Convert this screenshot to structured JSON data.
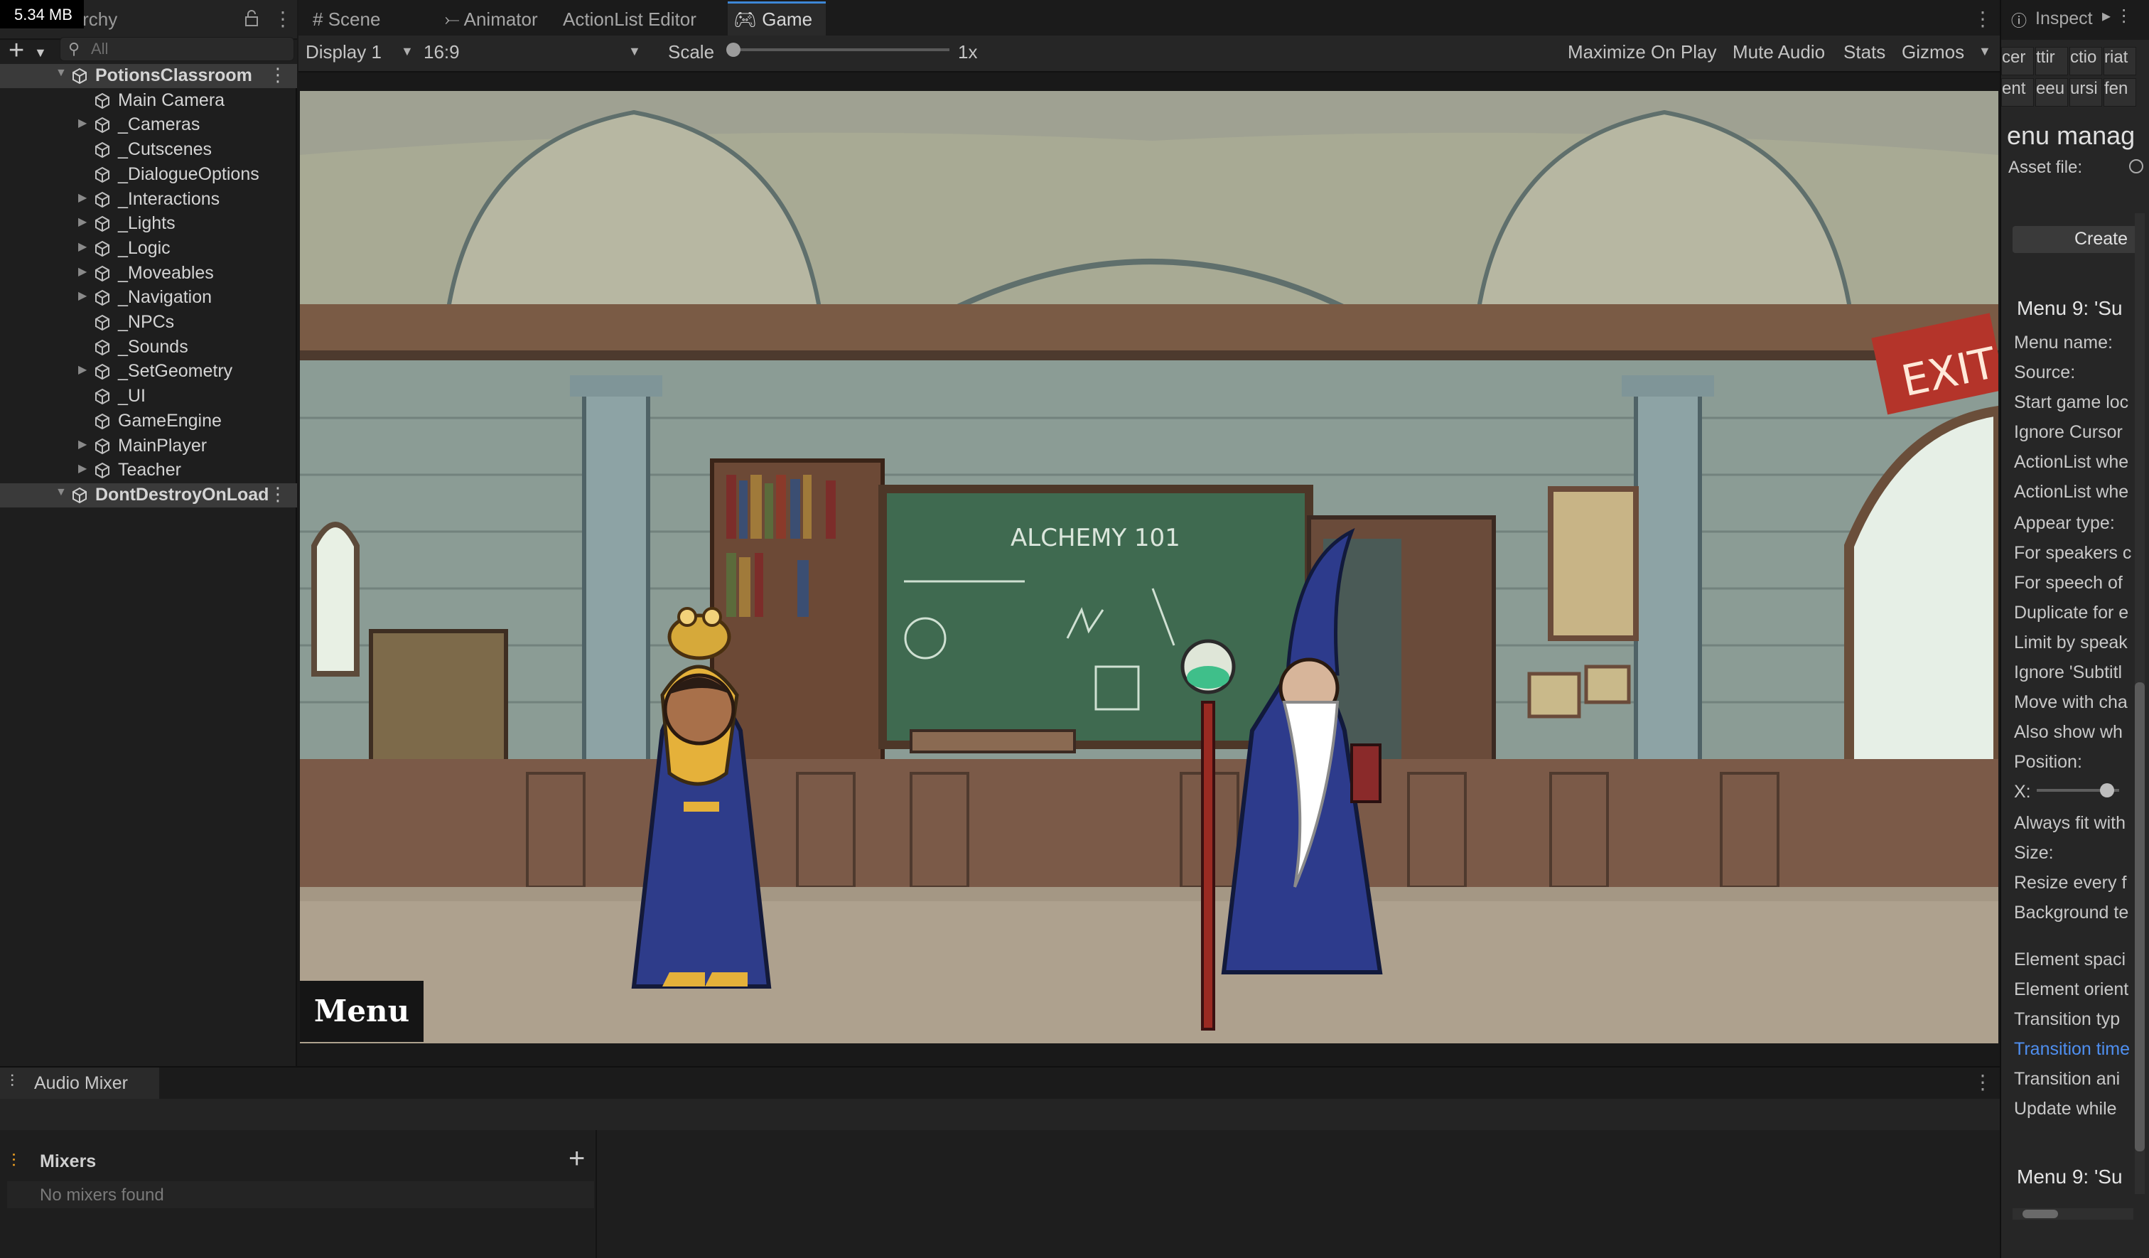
{
  "overlay": {
    "memory": "5.34 MB"
  },
  "hierarchy": {
    "tab_label": "Hierarchy",
    "search_placeholder": "All",
    "items": [
      {
        "label": "PotionsClassroom",
        "kind": "scene",
        "expandable": true,
        "selected": true
      },
      {
        "label": "Main Camera",
        "kind": "object",
        "expandable": false
      },
      {
        "label": "_Cameras",
        "kind": "object",
        "expandable": true
      },
      {
        "label": "_Cutscenes",
        "kind": "object",
        "expandable": false
      },
      {
        "label": "_DialogueOptions",
        "kind": "object",
        "expandable": false
      },
      {
        "label": "_Interactions",
        "kind": "object",
        "expandable": true
      },
      {
        "label": "_Lights",
        "kind": "object",
        "expandable": true
      },
      {
        "label": "_Logic",
        "kind": "object",
        "expandable": true
      },
      {
        "label": "_Moveables",
        "kind": "object",
        "expandable": true
      },
      {
        "label": "_Navigation",
        "kind": "object",
        "expandable": true
      },
      {
        "label": "_NPCs",
        "kind": "object",
        "expandable": false
      },
      {
        "label": "_Sounds",
        "kind": "object",
        "expandable": false
      },
      {
        "label": "_SetGeometry",
        "kind": "object",
        "expandable": true
      },
      {
        "label": "_UI",
        "kind": "object",
        "expandable": false
      },
      {
        "label": "GameEngine",
        "kind": "object",
        "expandable": false
      },
      {
        "label": "MainPlayer",
        "kind": "object",
        "expandable": true
      },
      {
        "label": "Teacher",
        "kind": "object",
        "expandable": true
      },
      {
        "label": "DontDestroyOnLoad",
        "kind": "scene",
        "expandable": true,
        "selected": true
      }
    ]
  },
  "editor_tabs": [
    {
      "label": "Scene",
      "icon": "grid-icon"
    },
    {
      "label": "Animator",
      "icon": "animator-icon"
    },
    {
      "label": "ActionList Editor",
      "icon": ""
    },
    {
      "label": "Game",
      "icon": "gamepad-icon",
      "active": true
    }
  ],
  "game_toolbar": {
    "display": "Display 1",
    "aspect": "16:9",
    "scale_label": "Scale",
    "scale_value": "1x",
    "scale_fraction": 0.0,
    "maximize": "Maximize On Play",
    "mute": "Mute Audio",
    "stats": "Stats",
    "gizmos": "Gizmos"
  },
  "game": {
    "menu_button": "Menu",
    "chalkboard_title": "ALCHEMY 101",
    "exit_sign": "EXIT"
  },
  "audio_mixer": {
    "tab_label": "Audio Mixer",
    "mixers_label": "Mixers",
    "empty_text": "No mixers found"
  },
  "inspector": {
    "tab_label": "Inspect",
    "subtabs": [
      "cer",
      "ttir",
      "ctio",
      "riat",
      "ent",
      "eeu",
      "ursi",
      "fen"
    ],
    "heading": "enu manag",
    "asset_label": "Asset file:",
    "create_button": "Create",
    "menu_title": "Menu 9: 'Su",
    "fields": [
      "Menu name:",
      "Source:",
      "Start game loc",
      "Ignore Cursor",
      "ActionList whe",
      "ActionList whe",
      "Appear type:",
      "For speakers c",
      "For speech of",
      "Duplicate for e",
      "Limit by speak",
      "Ignore 'Subtitl",
      "Move with cha",
      "Also show wh",
      "Position:",
      "X:",
      "Always fit with",
      "Size:",
      "Resize every f",
      "Background te",
      "Element spaci",
      "Element orient",
      "Transition typ",
      "Transition time",
      "Transition ani",
      "Update while"
    ],
    "highlight_field_index": 23,
    "menu_title_2": "Menu 9: 'Su",
    "x_slider_fraction": 0.85
  }
}
